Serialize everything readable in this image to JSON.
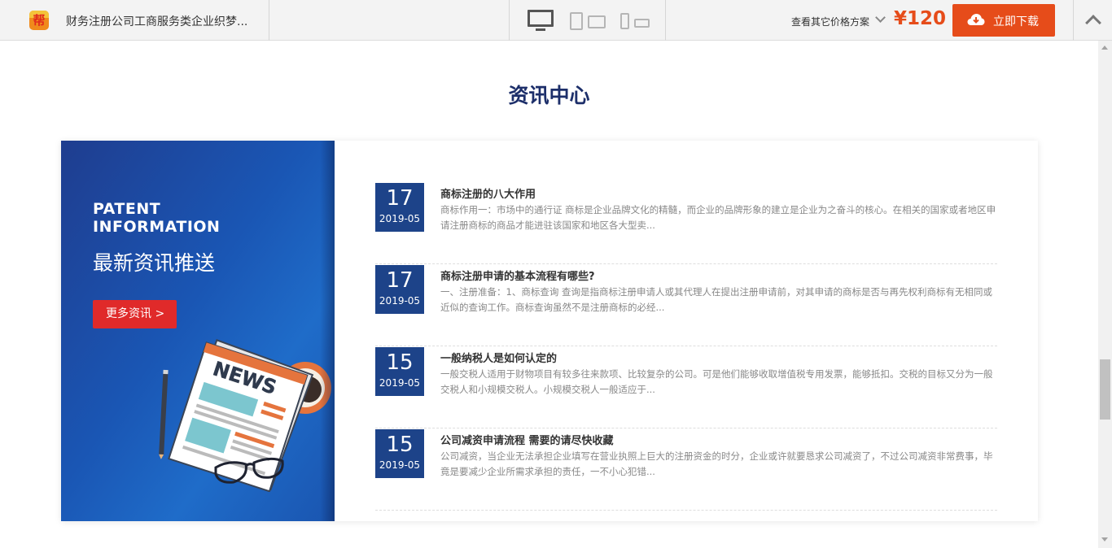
{
  "toolbar": {
    "logo_text": "帮",
    "doc_title": "财务注册公司工商服务类企业织梦...",
    "price_options_label": "查看其它价格方案",
    "price": "¥120",
    "download_label": "立即下载"
  },
  "section": {
    "title": "资讯中心"
  },
  "banner": {
    "heading_en_line1": "PATENT",
    "heading_en_line2": "INFORMATION",
    "heading_cn": "最新资讯推送",
    "more_button": "更多资讯 >",
    "illustration_text": "NEWS"
  },
  "news": [
    {
      "day": "17",
      "year_month": "2019-05",
      "title": "商标注册的八大作用",
      "desc": "商标作用一：市场中的通行证 商标是企业品牌文化的精髓，而企业的品牌形象的建立是企业为之奋斗的核心。在相关的国家或者地区申请注册商标的商品才能进驻该国家和地区各大型卖..."
    },
    {
      "day": "17",
      "year_month": "2019-05",
      "title": "商标注册申请的基本流程有哪些?",
      "desc": "一、注册准备：1、商标查询 查询是指商标注册申请人或其代理人在提出注册申请前，对其申请的商标是否与再先权利商标有无相同或近似的查询工作。商标查询虽然不是注册商标的必经..."
    },
    {
      "day": "15",
      "year_month": "2019-05",
      "title": "一般纳税人是如何认定的",
      "desc": "一般交税人适用于财物项目有较多往来款项、比较复杂的公司。可是他们能够收取增值税专用发票，能够抵扣。交税的目标又分为一般交税人和小规模交税人。小规模交税人一般适应于..."
    },
    {
      "day": "15",
      "year_month": "2019-05",
      "title": "公司减资申请流程 需要的请尽快收藏",
      "desc": "公司减资，当企业无法承担企业填写在营业执照上巨大的注册资金的时分，企业或许就要恳求公司减资了，不过公司减资非常费事，毕竟是要减少企业所需求承担的责任，一不小心犯错..."
    }
  ],
  "colors": {
    "accent_orange": "#e64c1a",
    "date_box_blue": "#1d4389",
    "title_navy": "#1d2f6a",
    "more_button_red": "#e02a2a"
  },
  "icons": [
    "logo-icon",
    "desktop-icon",
    "tablet-icon",
    "phone-icon",
    "chevron-down-icon",
    "cloud-download-icon",
    "chevron-up-icon"
  ]
}
